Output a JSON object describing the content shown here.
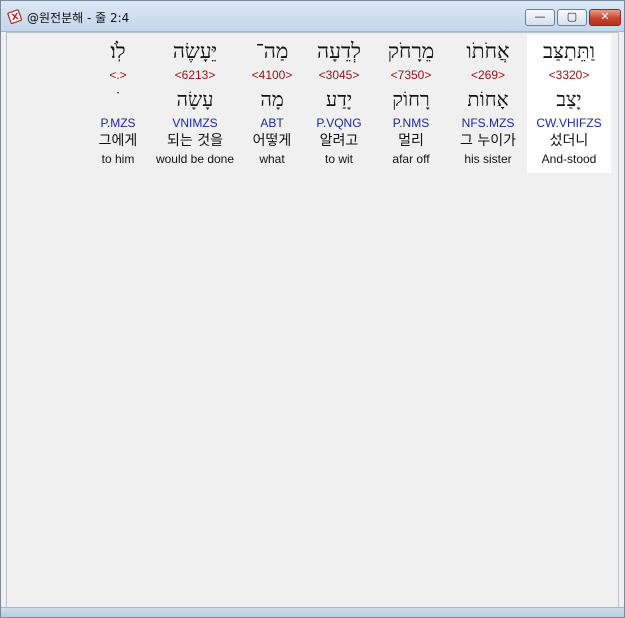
{
  "window": {
    "title": "@원전분해 - 줄 2:4",
    "minimize_glyph": "—",
    "maximize_glyph": "▢",
    "close_glyph": "✕",
    "app_icon": "book-cross-icon"
  },
  "words": [
    {
      "hebrew": "לֹֽו׃",
      "strong": "<.>",
      "lemma": "ֹ",
      "parse": "P.MZS",
      "korean": "그에게",
      "english": "to him"
    },
    {
      "hebrew": "יֵּעָשֶׂה",
      "strong": "<6213>",
      "lemma": "עָשָׂה",
      "parse": "VNIMZS",
      "korean": "되는 것을",
      "english": "would be done"
    },
    {
      "hebrew": "מַה־",
      "strong": "<4100>",
      "lemma": "מָה",
      "parse": "ABT",
      "korean": "어떻게",
      "english": "what"
    },
    {
      "hebrew": "לְדֵעָה",
      "strong": "<3045>",
      "lemma": "יָדַע",
      "parse": "P.VQNG",
      "korean": "알려고",
      "english": "to wit"
    },
    {
      "hebrew": "מֵרָחֹק",
      "strong": "<7350>",
      "lemma": "רָחוֹק",
      "parse": "P.NMS",
      "korean": "멀리",
      "english": "afar off"
    },
    {
      "hebrew": "אֲחֹתֹו",
      "strong": "<269>",
      "lemma": "אָחוֹת",
      "parse": "NFS.MZS",
      "korean": "그 누이가",
      "english": "his sister"
    },
    {
      "hebrew": "וַתֵּתַצַּב",
      "strong": "<3320>",
      "lemma": "יָצַב",
      "parse": "CW.VHIFZS",
      "korean": "섰더니",
      "english": "And-stood"
    }
  ],
  "colors": {
    "strong": "#9a1010",
    "parse": "#1a2aa0",
    "selected_bg": "#ffffff",
    "client_bg": "#f0f0f0"
  }
}
